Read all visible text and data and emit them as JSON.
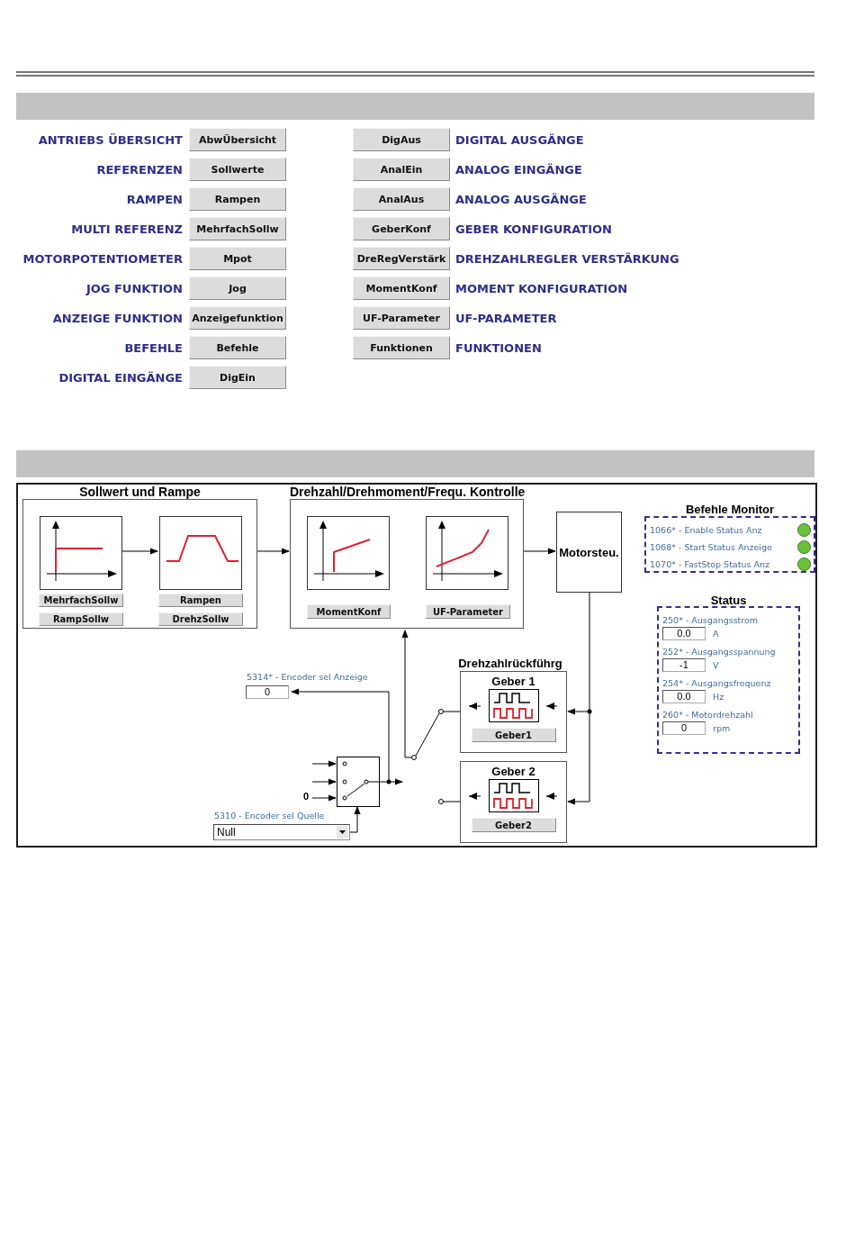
{
  "navigation": {
    "left": [
      {
        "label": "ANTRIEBS ÜBERSICHT",
        "button": "AbwÜbersicht"
      },
      {
        "label": "REFERENZEN",
        "button": "Sollwerte"
      },
      {
        "label": "RAMPEN",
        "button": "Rampen"
      },
      {
        "label": "MULTI REFERENZ",
        "button": "MehrfachSollw"
      },
      {
        "label": "MOTORPOTENTIOMETER",
        "button": "Mpot"
      },
      {
        "label": "JOG FUNKTION",
        "button": "Jog"
      },
      {
        "label": "ANZEIGE FUNKTION",
        "button": "Anzeigefunktion"
      },
      {
        "label": "BEFEHLE",
        "button": "Befehle"
      },
      {
        "label": "DIGITAL EINGÄNGE",
        "button": "DigEin"
      }
    ],
    "right": [
      {
        "button": "DigAus",
        "label": "DIGITAL AUSGÄNGE"
      },
      {
        "button": "AnalEin",
        "label": "ANALOG EINGÄNGE"
      },
      {
        "button": "AnalAus",
        "label": "ANALOG AUSGÄNGE"
      },
      {
        "button": "GeberKonf",
        "label": "GEBER KONFIGURATION"
      },
      {
        "button": "DreRegVerstärk",
        "label": "DREHZAHLREGLER VERSTÄRKUNG"
      },
      {
        "button": "MomentKonf",
        "label": "MOMENT KONFIGURATION"
      },
      {
        "button": "UF-Parameter",
        "label": "UF-PARAMETER"
      },
      {
        "button": "Funktionen",
        "label": "FUNKTIONEN"
      }
    ]
  },
  "diagram": {
    "panels": [
      {
        "title": "Sollwert und Rampe",
        "buttons": [
          "MehrfachSollw",
          "RampSollw",
          "Rampen",
          "DrehzSollw"
        ]
      },
      {
        "title": "Drehzahl/Drehmoment/Frequ. Kontrolle",
        "buttons": [
          "MomentKonf",
          "UF-Parameter"
        ]
      }
    ],
    "motor_block": "Motorsteu.",
    "command_monitor": {
      "title": "Befehle Monitor",
      "items": [
        {
          "label": "1066* - Enable Status Anz",
          "on": true
        },
        {
          "label": "1068* - Start Status Anzeige",
          "on": true
        },
        {
          "label": "1070* - FastStop Status Anz",
          "on": true
        }
      ]
    },
    "status": {
      "title": "Status",
      "fields": [
        {
          "label": "250* - Ausgangsstrom",
          "value": "0.0",
          "unit": "A"
        },
        {
          "label": "252* - Ausgangsspannung",
          "value": "-1",
          "unit": "V"
        },
        {
          "label": "254* - Ausgangsfrequenz",
          "value": "0.0",
          "unit": "Hz"
        },
        {
          "label": "260* - Motordrehzahl",
          "value": "0",
          "unit": "rpm"
        }
      ]
    },
    "feedback": {
      "title": "Drehzahlrückführg",
      "encoders": [
        {
          "title": "Geber 1",
          "button": "Geber1"
        },
        {
          "title": "Geber 2",
          "button": "Geber2"
        }
      ]
    },
    "encoder_display": {
      "label": "5314* - Encoder sel Anzeige",
      "value": "0"
    },
    "switch_input": "0",
    "encoder_source": {
      "label": "5310 - Encoder sel Quelle",
      "value": "Null"
    }
  }
}
